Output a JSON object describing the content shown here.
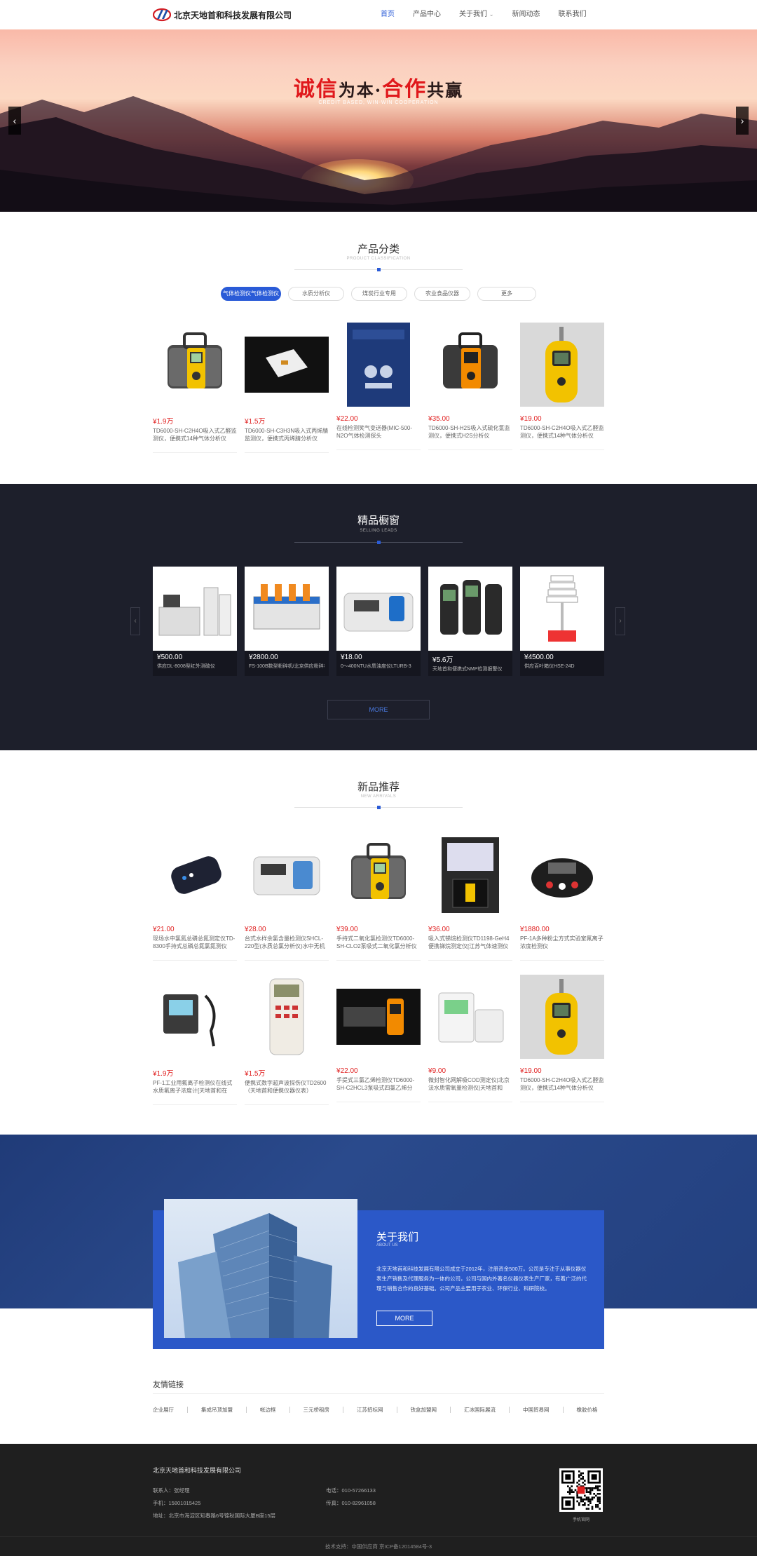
{
  "header": {
    "company": "北京天地首和科技发展有限公司",
    "nav": [
      "首页",
      "产品中心",
      "关于我们",
      "新闻动态",
      "联系我们"
    ],
    "nav_dropdown_marker": "⌄"
  },
  "banner": {
    "slogan_red_1": "诚信",
    "slogan_dark_1": "为本·",
    "slogan_red_2": "合作",
    "slogan_dark_2": "共赢",
    "slogan_sub": "CREDIT BASED, WIN-WIN COOPERATION",
    "prev": "‹",
    "next": "›",
    "slide_count": 4,
    "active_slide": 1
  },
  "categories": {
    "title": "产品分类",
    "subtitle": "PRODUCT CLASSIFICATION",
    "tabs": [
      "气体检测仪气体检测仪",
      "水质分析仪",
      "煤炭行业专用",
      "农业食品仪器",
      "更多"
    ],
    "products": [
      {
        "price": "1.9万",
        "name": "TD6000-SH-C2H4O吸入式乙醛监测仪，便携式14种气体分析仪"
      },
      {
        "price": "1.5万",
        "name": "TD6000-SH-C3H3N吸入式丙烯腈监测仪，便携式丙烯腈分析仪"
      },
      {
        "price": "22.00",
        "name": "在线检测笑气变送器(MIC-500-N2O气体检测探头"
      },
      {
        "price": "35.00",
        "name": "TD6000-SH-H2S吸入式硫化氢监测仪，便携式H2S分析仪"
      },
      {
        "price": "19.00",
        "name": "TD6000-SH-C2H4O吸入式乙醛监测仪，便携式14种气体分析仪"
      }
    ]
  },
  "selling": {
    "title": "精品橱窗",
    "subtitle": "SELLING LEADS",
    "prev": "‹",
    "next": "›",
    "more": "MORE",
    "products": [
      {
        "price": "500.00",
        "name": "供应DL-8008型红外测硫仪"
      },
      {
        "price": "2800.00",
        "name": "FS-100B数型粉碎机/北京供应粉碎机"
      },
      {
        "price": "18.00",
        "name": "0～400NTU水质浊度仪LTURB-3"
      },
      {
        "price": "5.6万",
        "name": "天地首和便携式NMP检测报警仪"
      },
      {
        "price": "4500.00",
        "name": "供应百叶箱仪HSE-24D"
      }
    ]
  },
  "arrivals": {
    "title": "新品推荐",
    "subtitle": "NEW ARRIVALS",
    "products": [
      {
        "price": "21.00",
        "name": "现场水中氯氮总磷总氮测定仪TD-8300手持式总磷总氮氯氮测仪"
      },
      {
        "price": "28.00",
        "name": "台式水样余氯含量检测仪SHCL-220型(水质总氯分析仪)水中无机盐"
      },
      {
        "price": "39.00",
        "name": "手持式二氧化氯检测仪TD6000-SH-CLO2泵吸式二氧化氯分析仪[深圳"
      },
      {
        "price": "36.00",
        "name": "吸入式锑烷检测仪TD1198-GeH4便携锑烷测定仪[江苏气体速测仪"
      },
      {
        "price": "1880.00",
        "name": "PF-1A多种粉尘方式实验室氟离子浓度检测仪"
      },
      {
        "price": "1.9万",
        "name": "PF-1工业用氟离子检测仪在线式水质氟离子浓度计[天地首和在"
      },
      {
        "price": "1.5万",
        "name": "便携式数字超声波探伤仪TD2600（天地首和便携仪器仪表）"
      },
      {
        "price": "22.00",
        "name": "手提式三氯乙烯检测仪TD6000-SH-C2HCL3泵吸式四氯乙烯分"
      },
      {
        "price": "9.00",
        "name": "微封智化网解吸COD测定仪|北京法水质需氧量检测仪|天地首和"
      },
      {
        "price": "19.00",
        "name": "TD6000-SH-C2H4O吸入式乙醛监测仪，便携式14种气体分析仪"
      }
    ]
  },
  "about": {
    "title": "关于我们",
    "subtitle": "ABOUT US",
    "text": "北京天地首和科技发展有限公司成立于2012年，注册资金500万。公司是专注于从事仪器仪表生产销售及代理服务为一体的公司，公司与国内外著名仪器仪表生产厂家，有着广泛的代理与销售合作的良好基础。公司产品主要用于农业、环保行业、科研院校。",
    "more": "MORE"
  },
  "links": {
    "title": "友情链接",
    "items": [
      "企业展厅",
      "集成吊顶加盟",
      "帐边框",
      "三元桥租房",
      "江苏招标网",
      "铁盒加盟网",
      "汇冰国际展流",
      "中国贸易网",
      "橡胶价格"
    ]
  },
  "footer": {
    "company": "北京天地首和科技发展有限公司",
    "contact": "联系人：张经理",
    "mobile": "手机：15801015425",
    "address": "地址：北京市海淀区知春路6号锦秋国际大厦B座15层",
    "phone": "电话：010-57266133",
    "fax": "传真：010-82961058",
    "qr_label": "手机官网",
    "copyright": "技术支持：中国供应商   京ICP备12014584号-3"
  },
  "colors": {
    "accent": "#2a5bd7",
    "price": "#e02020",
    "dark_bg": "#1d1f2b",
    "about_blue": "#2b58c8",
    "footer": "#1f1f1f"
  }
}
